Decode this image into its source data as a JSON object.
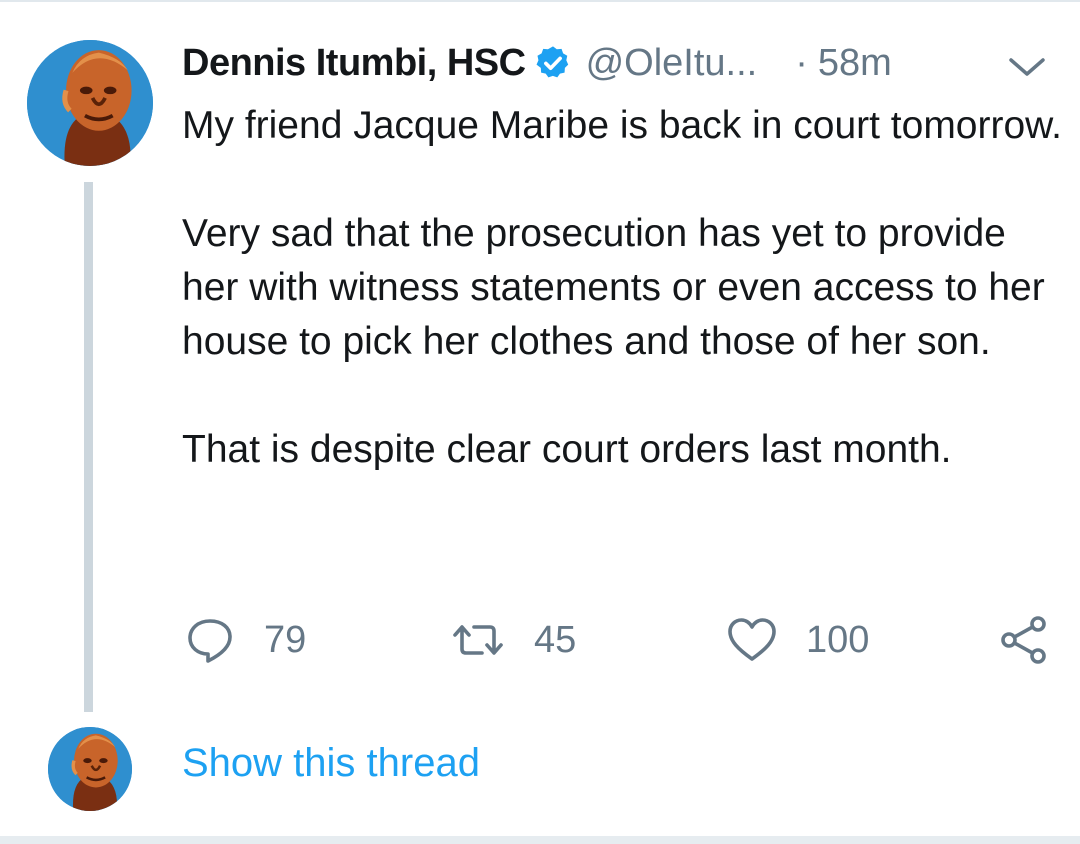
{
  "tweet": {
    "author": {
      "display_name": "Dennis Itumbi, HSC",
      "handle": "@OleItu...",
      "verified": true,
      "avatar_icon": "user-avatar"
    },
    "time": "58m",
    "time_separator": "·",
    "text": [
      "My friend Jacque Maribe is back in court tomorrow.",
      "Very sad that the prosecution has yet to provide her with witness statements or even access to her house to pick her clothes and those of her son.",
      "That is despite clear court orders last month."
    ],
    "actions": {
      "reply": {
        "icon": "reply-icon",
        "count": "79"
      },
      "retweet": {
        "icon": "retweet-icon",
        "count": "45"
      },
      "like": {
        "icon": "heart-icon",
        "count": "100"
      },
      "share": {
        "icon": "share-icon"
      }
    }
  },
  "thread": {
    "link_label": "Show this thread"
  },
  "colors": {
    "text": "#14171a",
    "secondary": "#657786",
    "accent": "#1da1f2",
    "thread_line": "#ccd6dd"
  }
}
